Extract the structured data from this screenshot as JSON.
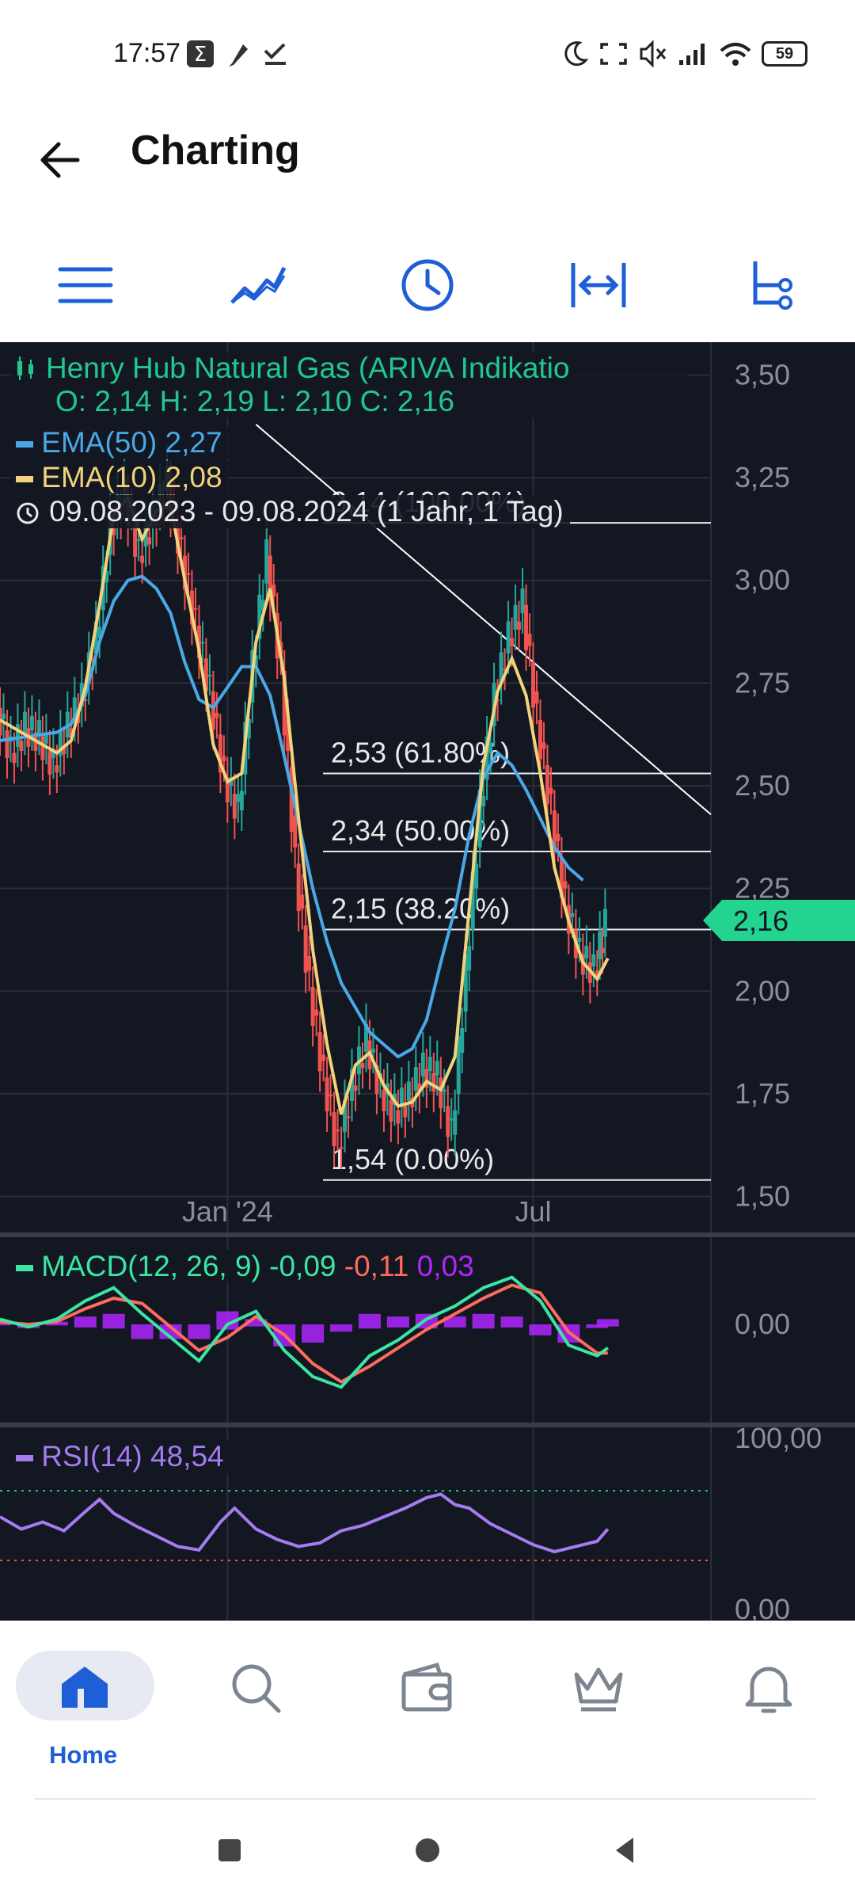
{
  "status_bar": {
    "time": "17:57",
    "battery": "59"
  },
  "header": {
    "title": "Charting"
  },
  "toolbar": {
    "icons": [
      "menu-icon",
      "line-chart-icon",
      "clock-icon",
      "range-icon",
      "indicator-tree-icon"
    ]
  },
  "chart_data": {
    "type": "line",
    "instrument": "Henry Hub Natural Gas (ARIVA Indikatio",
    "ohlc_text": "O: 2,14  H: 2,19  L: 2,10  C: 2,16",
    "ema50_label": "EMA(50)",
    "ema50_value": "2,27",
    "ema10_label": "EMA(10)",
    "ema10_value": "2,08",
    "range_label": "09.08.2023 - 09.08.2024  (1 Jahr, 1 Tag)",
    "current_price": "2,16",
    "ylim": [
      1.42,
      3.58
    ],
    "y_ticks": [
      "3,50",
      "3,25",
      "3,00",
      "2,75",
      "2,50",
      "2,25",
      "2,00",
      "1,75",
      "1,50"
    ],
    "x_ticks": [
      "Jan '24",
      "Jul"
    ],
    "fib_levels": [
      {
        "value": 3.14,
        "label": "3,14 (100.00%)"
      },
      {
        "value": 2.53,
        "label": "2,53 (61.80%)"
      },
      {
        "value": 2.34,
        "label": "2,34 (50.00%)"
      },
      {
        "value": 2.15,
        "label": "2,15 (38.20%)"
      },
      {
        "value": 1.54,
        "label": "1,54 (0.00%)"
      }
    ],
    "trendline": [
      [
        0.36,
        3.38
      ],
      [
        1.0,
        2.43
      ]
    ],
    "price_series": [
      [
        0.0,
        2.69
      ],
      [
        0.02,
        2.58
      ],
      [
        0.04,
        2.64
      ],
      [
        0.06,
        2.62
      ],
      [
        0.08,
        2.55
      ],
      [
        0.1,
        2.64
      ],
      [
        0.12,
        2.71
      ],
      [
        0.14,
        2.86
      ],
      [
        0.16,
        3.13
      ],
      [
        0.18,
        3.21
      ],
      [
        0.2,
        3.06
      ],
      [
        0.22,
        3.15
      ],
      [
        0.24,
        3.24
      ],
      [
        0.26,
        3.06
      ],
      [
        0.28,
        2.89
      ],
      [
        0.3,
        2.73
      ],
      [
        0.32,
        2.52
      ],
      [
        0.34,
        2.44
      ],
      [
        0.36,
        2.79
      ],
      [
        0.38,
        3.06
      ],
      [
        0.4,
        2.78
      ],
      [
        0.42,
        2.31
      ],
      [
        0.44,
        2.01
      ],
      [
        0.46,
        1.79
      ],
      [
        0.48,
        1.62
      ],
      [
        0.5,
        1.77
      ],
      [
        0.52,
        1.88
      ],
      [
        0.54,
        1.76
      ],
      [
        0.56,
        1.71
      ],
      [
        0.58,
        1.74
      ],
      [
        0.6,
        1.81
      ],
      [
        0.62,
        1.79
      ],
      [
        0.64,
        1.65
      ],
      [
        0.66,
        2.05
      ],
      [
        0.68,
        2.45
      ],
      [
        0.7,
        2.71
      ],
      [
        0.72,
        2.86
      ],
      [
        0.74,
        2.94
      ],
      [
        0.76,
        2.66
      ],
      [
        0.78,
        2.44
      ],
      [
        0.8,
        2.21
      ],
      [
        0.82,
        2.09
      ],
      [
        0.84,
        2.05
      ],
      [
        0.855,
        2.16
      ]
    ],
    "ema10_series": [
      [
        0.0,
        2.66
      ],
      [
        0.04,
        2.62
      ],
      [
        0.08,
        2.58
      ],
      [
        0.1,
        2.61
      ],
      [
        0.12,
        2.74
      ],
      [
        0.14,
        2.94
      ],
      [
        0.16,
        3.16
      ],
      [
        0.18,
        3.2
      ],
      [
        0.2,
        3.1
      ],
      [
        0.22,
        3.17
      ],
      [
        0.24,
        3.18
      ],
      [
        0.26,
        3.0
      ],
      [
        0.28,
        2.83
      ],
      [
        0.3,
        2.6
      ],
      [
        0.32,
        2.51
      ],
      [
        0.34,
        2.53
      ],
      [
        0.36,
        2.85
      ],
      [
        0.38,
        2.98
      ],
      [
        0.4,
        2.76
      ],
      [
        0.42,
        2.42
      ],
      [
        0.44,
        2.1
      ],
      [
        0.46,
        1.87
      ],
      [
        0.48,
        1.7
      ],
      [
        0.5,
        1.82
      ],
      [
        0.52,
        1.85
      ],
      [
        0.54,
        1.77
      ],
      [
        0.56,
        1.72
      ],
      [
        0.58,
        1.73
      ],
      [
        0.6,
        1.78
      ],
      [
        0.62,
        1.76
      ],
      [
        0.64,
        1.84
      ],
      [
        0.66,
        2.2
      ],
      [
        0.68,
        2.55
      ],
      [
        0.7,
        2.73
      ],
      [
        0.72,
        2.81
      ],
      [
        0.74,
        2.72
      ],
      [
        0.76,
        2.53
      ],
      [
        0.78,
        2.3
      ],
      [
        0.8,
        2.17
      ],
      [
        0.82,
        2.07
      ],
      [
        0.84,
        2.03
      ],
      [
        0.855,
        2.08
      ]
    ],
    "ema50_series": [
      [
        0.0,
        2.61
      ],
      [
        0.04,
        2.62
      ],
      [
        0.08,
        2.63
      ],
      [
        0.1,
        2.65
      ],
      [
        0.12,
        2.72
      ],
      [
        0.14,
        2.85
      ],
      [
        0.16,
        2.95
      ],
      [
        0.18,
        3.0
      ],
      [
        0.2,
        3.01
      ],
      [
        0.22,
        2.98
      ],
      [
        0.24,
        2.92
      ],
      [
        0.26,
        2.8
      ],
      [
        0.28,
        2.71
      ],
      [
        0.3,
        2.69
      ],
      [
        0.32,
        2.74
      ],
      [
        0.34,
        2.79
      ],
      [
        0.36,
        2.79
      ],
      [
        0.38,
        2.72
      ],
      [
        0.4,
        2.57
      ],
      [
        0.42,
        2.41
      ],
      [
        0.44,
        2.25
      ],
      [
        0.46,
        2.12
      ],
      [
        0.48,
        2.02
      ],
      [
        0.5,
        1.96
      ],
      [
        0.52,
        1.9
      ],
      [
        0.54,
        1.87
      ],
      [
        0.56,
        1.84
      ],
      [
        0.58,
        1.86
      ],
      [
        0.6,
        1.93
      ],
      [
        0.62,
        2.07
      ],
      [
        0.64,
        2.2
      ],
      [
        0.66,
        2.38
      ],
      [
        0.68,
        2.52
      ],
      [
        0.7,
        2.58
      ],
      [
        0.72,
        2.55
      ],
      [
        0.74,
        2.49
      ],
      [
        0.76,
        2.42
      ],
      [
        0.78,
        2.35
      ],
      [
        0.8,
        2.3
      ],
      [
        0.82,
        2.27
      ]
    ],
    "x_tick_positions": [
      0.32,
      0.75
    ],
    "macd": {
      "label": "MACD(12, 26, 9)",
      "macd_value": "-0,09",
      "signal_value": "-0,11",
      "hist_value": "0,03",
      "y_tick": "0,00",
      "macd_series": [
        [
          0.0,
          0.02
        ],
        [
          0.04,
          -0.01
        ],
        [
          0.08,
          0.02
        ],
        [
          0.12,
          0.09
        ],
        [
          0.16,
          0.14
        ],
        [
          0.2,
          0.04
        ],
        [
          0.24,
          -0.05
        ],
        [
          0.28,
          -0.14
        ],
        [
          0.32,
          0.0
        ],
        [
          0.36,
          0.05
        ],
        [
          0.4,
          -0.1
        ],
        [
          0.44,
          -0.2
        ],
        [
          0.48,
          -0.24
        ],
        [
          0.52,
          -0.12
        ],
        [
          0.56,
          -0.06
        ],
        [
          0.6,
          0.02
        ],
        [
          0.64,
          0.07
        ],
        [
          0.68,
          0.14
        ],
        [
          0.72,
          0.18
        ],
        [
          0.76,
          0.09
        ],
        [
          0.8,
          -0.08
        ],
        [
          0.84,
          -0.12
        ],
        [
          0.855,
          -0.09
        ]
      ],
      "signal_series": [
        [
          0.0,
          0.01
        ],
        [
          0.04,
          0.0
        ],
        [
          0.08,
          0.01
        ],
        [
          0.12,
          0.06
        ],
        [
          0.16,
          0.1
        ],
        [
          0.2,
          0.08
        ],
        [
          0.24,
          -0.01
        ],
        [
          0.28,
          -0.1
        ],
        [
          0.32,
          -0.05
        ],
        [
          0.36,
          0.03
        ],
        [
          0.4,
          -0.04
        ],
        [
          0.44,
          -0.15
        ],
        [
          0.48,
          -0.22
        ],
        [
          0.52,
          -0.16
        ],
        [
          0.56,
          -0.09
        ],
        [
          0.6,
          -0.02
        ],
        [
          0.64,
          0.04
        ],
        [
          0.68,
          0.1
        ],
        [
          0.72,
          0.15
        ],
        [
          0.76,
          0.12
        ],
        [
          0.8,
          -0.03
        ],
        [
          0.84,
          -0.11
        ],
        [
          0.855,
          -0.11
        ]
      ]
    },
    "rsi": {
      "label": "RSI(14)",
      "value": "48,54",
      "top_tick": "100,00",
      "bottom_tick": "0,00",
      "series": [
        [
          0.0,
          55
        ],
        [
          0.03,
          48
        ],
        [
          0.06,
          52
        ],
        [
          0.09,
          47
        ],
        [
          0.12,
          58
        ],
        [
          0.14,
          65
        ],
        [
          0.16,
          57
        ],
        [
          0.19,
          50
        ],
        [
          0.22,
          44
        ],
        [
          0.25,
          38
        ],
        [
          0.28,
          36
        ],
        [
          0.31,
          52
        ],
        [
          0.33,
          60
        ],
        [
          0.36,
          48
        ],
        [
          0.39,
          42
        ],
        [
          0.42,
          38
        ],
        [
          0.45,
          40
        ],
        [
          0.48,
          47
        ],
        [
          0.51,
          50
        ],
        [
          0.54,
          55
        ],
        [
          0.57,
          60
        ],
        [
          0.6,
          66
        ],
        [
          0.62,
          68
        ],
        [
          0.64,
          62
        ],
        [
          0.66,
          60
        ],
        [
          0.69,
          51
        ],
        [
          0.72,
          45
        ],
        [
          0.75,
          39
        ],
        [
          0.78,
          35
        ],
        [
          0.81,
          38
        ],
        [
          0.84,
          41
        ],
        [
          0.855,
          48
        ]
      ]
    }
  },
  "bottom_nav": {
    "home_label": "Home"
  }
}
